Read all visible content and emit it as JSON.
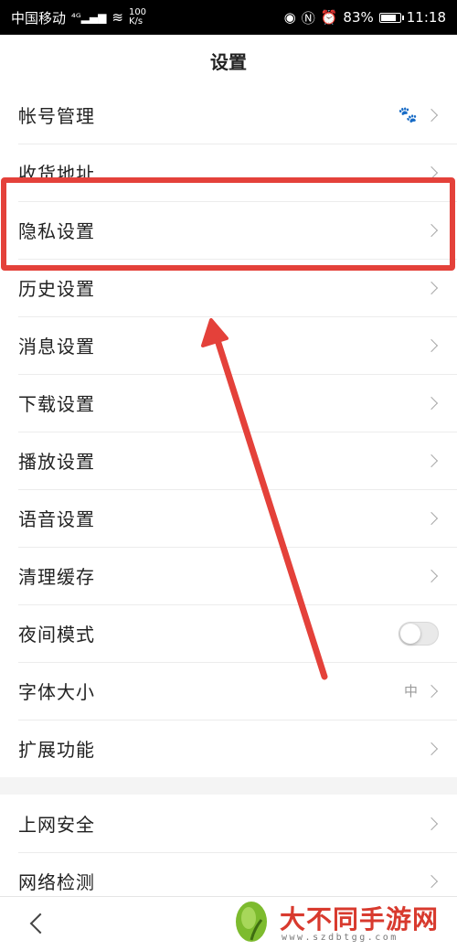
{
  "status": {
    "carrier": "中国移动",
    "net_type": "4G",
    "speed_top": "100",
    "speed_bottom": "K/s",
    "battery": "83%",
    "battery_level": 0.83,
    "time": "11:18"
  },
  "header": {
    "title": "设置"
  },
  "group1": [
    {
      "label": "帐号管理",
      "right": "paw-icon"
    },
    {
      "label": "收货地址"
    },
    {
      "label": "隐私设置"
    },
    {
      "label": "历史设置"
    },
    {
      "label": "消息设置"
    },
    {
      "label": "下载设置"
    },
    {
      "label": "播放设置"
    },
    {
      "label": "语音设置"
    },
    {
      "label": "清理缓存"
    },
    {
      "label": "夜间模式",
      "toggle": false
    },
    {
      "label": "字体大小",
      "value": "中"
    },
    {
      "label": "扩展功能"
    }
  ],
  "group2": [
    {
      "label": "上网安全"
    },
    {
      "label": "网络检测"
    }
  ],
  "watermark": {
    "name": "大不同手游网",
    "url": "www.szdbtgg.com"
  },
  "colors": {
    "highlight": "#e4413a",
    "background": "#f4f4f4"
  }
}
